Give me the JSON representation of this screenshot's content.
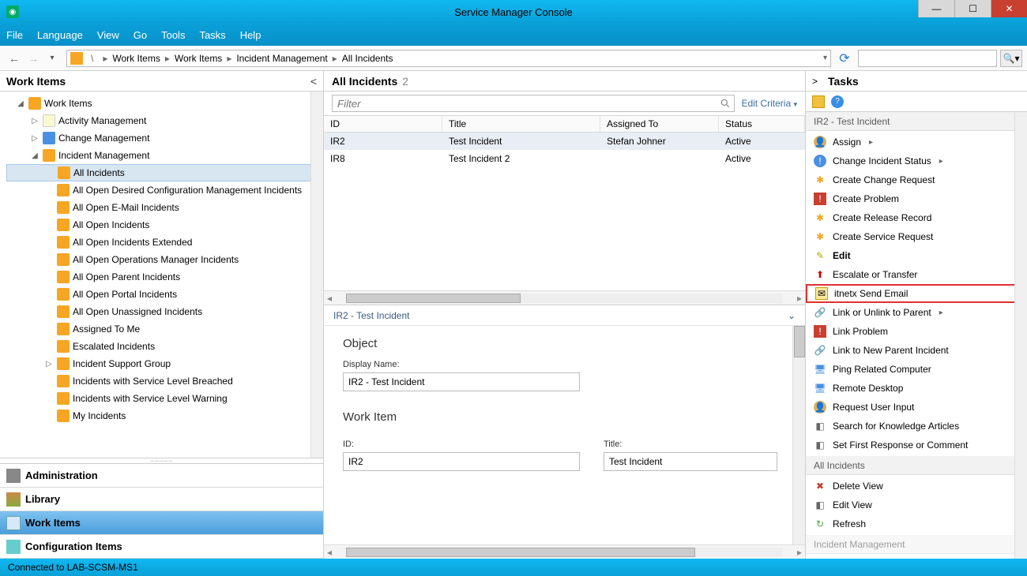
{
  "window_title": "Service Manager Console",
  "menus": [
    "File",
    "Language",
    "View",
    "Go",
    "Tools",
    "Tasks",
    "Help"
  ],
  "breadcrumb": [
    "Work Items",
    "Work Items",
    "Incident Management",
    "All Incidents"
  ],
  "left_pane_title": "Work Items",
  "tree": {
    "root": "Work Items",
    "items": [
      {
        "label": "Activity Management",
        "expandable": true
      },
      {
        "label": "Change Management",
        "expandable": true,
        "blue": true
      },
      {
        "label": "Incident Management",
        "expandable": true,
        "children": [
          "All Incidents",
          "All Open Desired Configuration Management Incidents",
          "All Open E-Mail Incidents",
          "All Open Incidents",
          "All Open Incidents Extended",
          "All Open Operations Manager Incidents",
          "All Open Parent Incidents",
          "All Open Portal Incidents",
          "All Open Unassigned Incidents",
          "Assigned To Me",
          "Escalated Incidents",
          "Incident Support Group",
          "Incidents with Service Level Breached",
          "Incidents with Service Level Warning",
          "My Incidents"
        ],
        "selected_child": 0,
        "support_group_expandable": true
      }
    ]
  },
  "wunderbars": [
    "Administration",
    "Library",
    "Work Items",
    "Configuration Items"
  ],
  "wunderbar_active": "Work Items",
  "grid": {
    "title": "All Incidents",
    "count": "2",
    "filter_placeholder": "Filter",
    "edit_criteria": "Edit Criteria",
    "columns": [
      "ID",
      "Title",
      "Assigned To",
      "Status"
    ],
    "rows": [
      {
        "id": "IR2",
        "title": "Test Incident",
        "assigned": "Stefan Johner",
        "status": "Active",
        "selected": true
      },
      {
        "id": "IR8",
        "title": "Test Incident 2",
        "assigned": "",
        "status": "Active"
      }
    ]
  },
  "detail": {
    "header": "IR2 - Test Incident",
    "section1": "Object",
    "display_name_label": "Display Name:",
    "display_name_value": "IR2 - Test Incident",
    "section2": "Work Item",
    "id_label": "ID:",
    "id_value": "IR2",
    "title_label": "Title:",
    "title_value": "Test Incident"
  },
  "tasks": {
    "pane_title": "Tasks",
    "group1_title": "IR2 - Test Incident",
    "group1_items": [
      {
        "label": "Assign",
        "arrow": true,
        "icon": "assign"
      },
      {
        "label": "Change Incident Status",
        "arrow": true,
        "icon": "blueinfo"
      },
      {
        "label": "Create Change Request",
        "icon": "star"
      },
      {
        "label": "Create Problem",
        "icon": "redex"
      },
      {
        "label": "Create Release Record",
        "icon": "star"
      },
      {
        "label": "Create Service Request",
        "icon": "star"
      },
      {
        "label": "Edit",
        "bold": true,
        "icon": "pencil"
      },
      {
        "label": "Escalate or Transfer",
        "icon": "up"
      },
      {
        "label": "itnetx Send Email",
        "highlight": true,
        "icon": "mail"
      },
      {
        "label": "Link or Unlink to Parent",
        "arrow": true,
        "icon": "link"
      },
      {
        "label": "Link Problem",
        "icon": "redex"
      },
      {
        "label": "Link to New Parent Incident",
        "icon": "link"
      },
      {
        "label": "Ping Related Computer",
        "icon": "mon"
      },
      {
        "label": "Remote Desktop",
        "icon": "mon"
      },
      {
        "label": "Request User Input",
        "icon": "assign"
      },
      {
        "label": "Search for Knowledge Articles",
        "icon": "gray"
      },
      {
        "label": "Set First Response or Comment",
        "icon": "gray"
      }
    ],
    "group2_title": "All Incidents",
    "group2_items": [
      {
        "label": "Delete View",
        "icon": "del"
      },
      {
        "label": "Edit View",
        "icon": "gray"
      },
      {
        "label": "Refresh",
        "icon": "green"
      }
    ],
    "group3_title": "Incident Management"
  },
  "status_text": "Connected to LAB-SCSM-MS1"
}
